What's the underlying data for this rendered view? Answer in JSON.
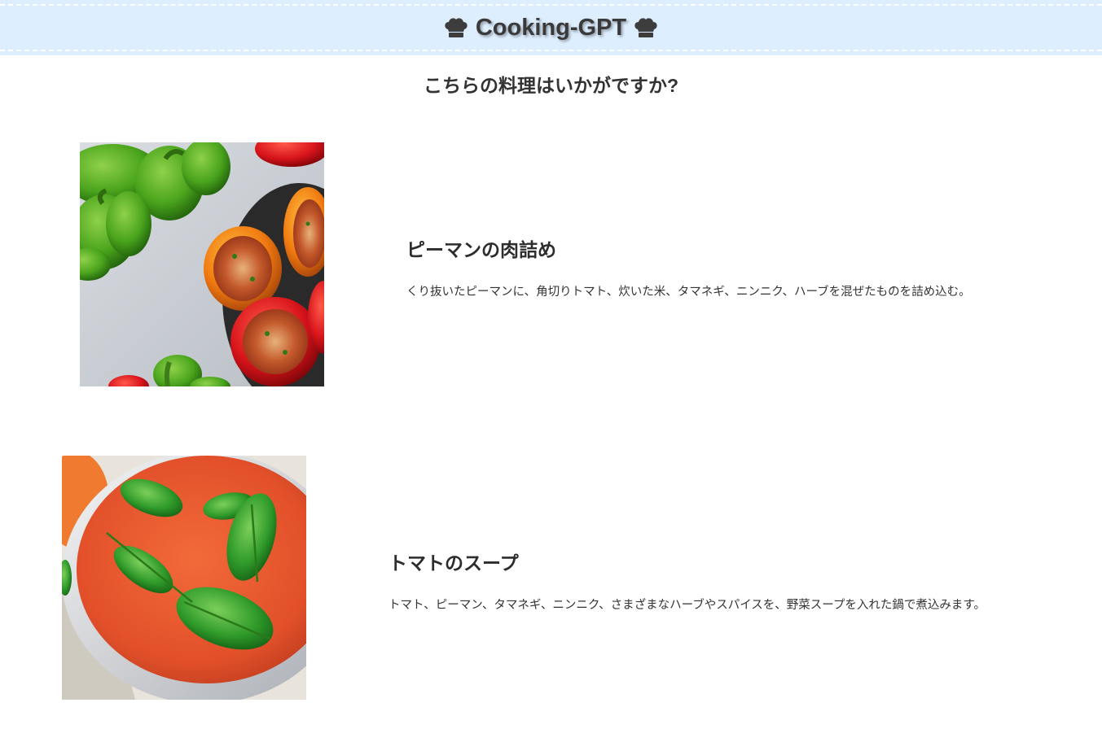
{
  "header": {
    "title": "Cooking-GPT",
    "left_icon": "chef-hat-icon",
    "right_icon": "chef-hat-icon",
    "background_color": "#ddeeff"
  },
  "subtitle": "こちらの料理はいかがですか?",
  "dishes": [
    {
      "name": "ピーマンの肉詰め",
      "description": "くり抜いたピーマンに、角切りトマト、炊いた米、タマネギ、ニンニク、ハーブを混ぜたものを詰め込む。",
      "image": "stuffed-peppers-photo"
    },
    {
      "name": "トマトのスープ",
      "description": "トマト、ピーマン、タマネギ、ニンニク、さまざまなハーブやスパイスを、野菜スープを入れた鍋で煮込みます。",
      "image": "tomato-soup-photo"
    }
  ]
}
